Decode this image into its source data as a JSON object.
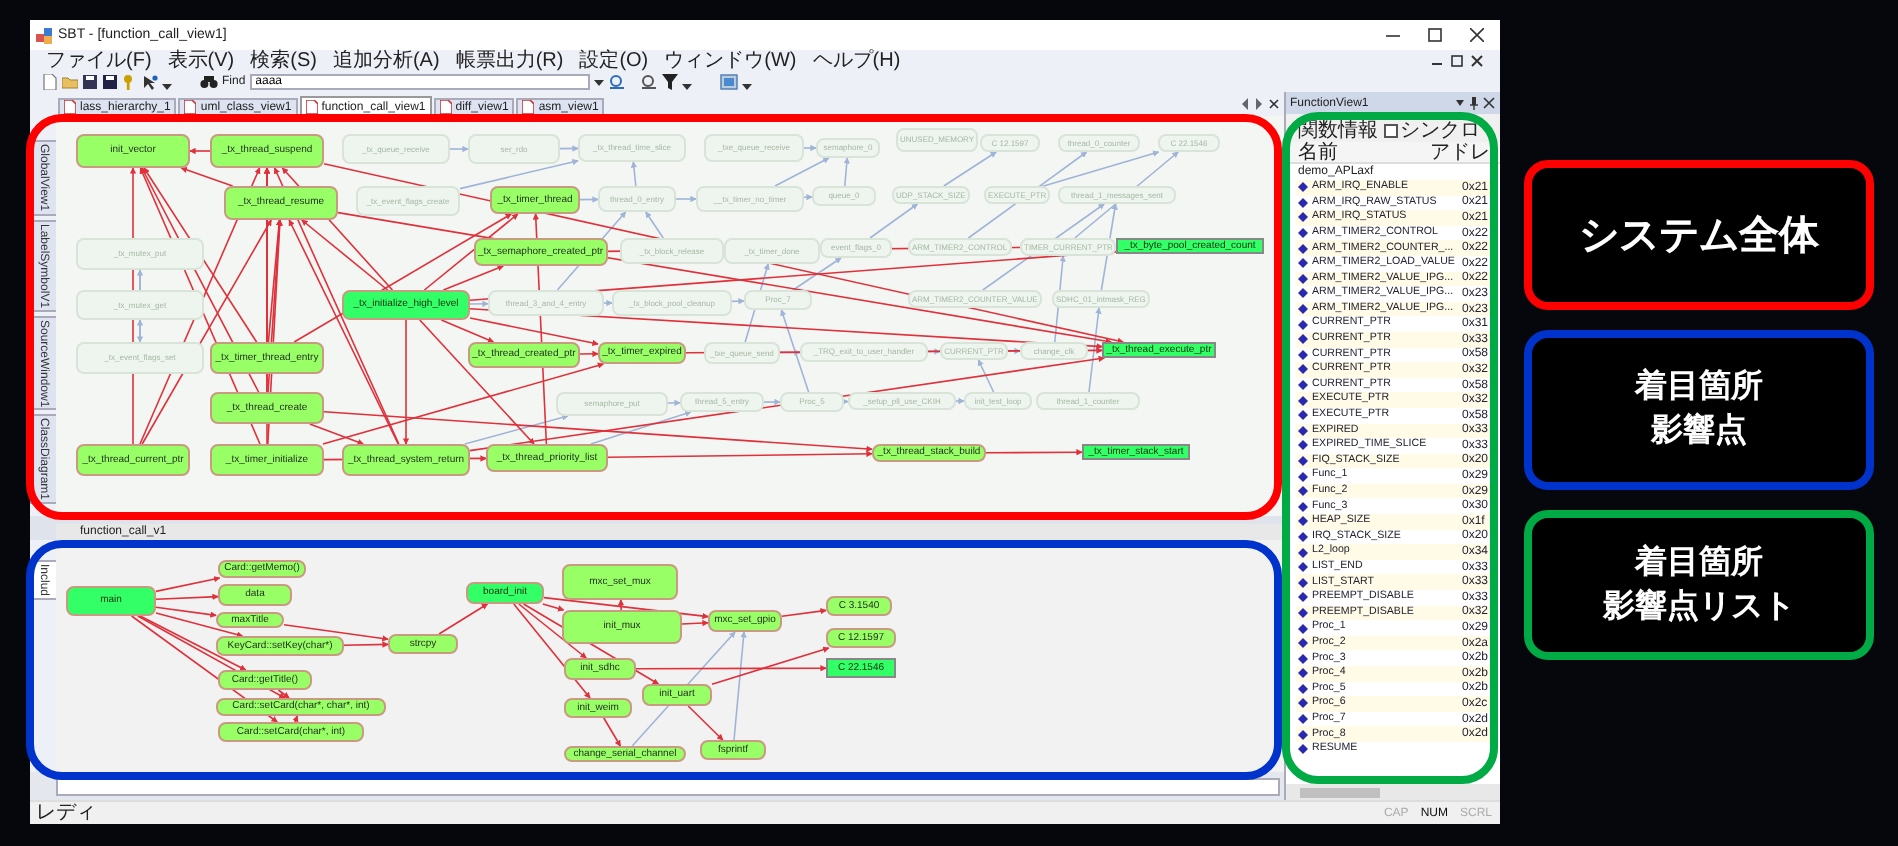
{
  "window": {
    "title": "SBT - [function_call_view1]"
  },
  "menu": [
    "ファイル(F)",
    "表示(V)",
    "検索(S)",
    "追加分析(A)",
    "帳票出力(R)",
    "設定(O)",
    "ウィンドウ(W)",
    "ヘルプ(H)"
  ],
  "toolbar": {
    "find_label": "Find",
    "find_value": "aaaa"
  },
  "document_tabs": [
    {
      "label": "lass_hierarchy_1",
      "selected": false
    },
    {
      "label": "uml_class_view1",
      "selected": false
    },
    {
      "label": "function_call_view1",
      "selected": true
    },
    {
      "label": "diff_view1",
      "selected": false
    },
    {
      "label": "asm_view1",
      "selected": false
    }
  ],
  "side_tabs": [
    "GlobalView1",
    "LabelSymbolV1",
    "SourceWindow1",
    "ClassDiagram1"
  ],
  "system_graph": {
    "nodes": [
      {
        "label": "init_vector",
        "kind": "node"
      },
      {
        "label": "_tx_thread_suspend",
        "kind": "node"
      },
      {
        "label": "_tx_thread_resume",
        "kind": "node"
      },
      {
        "label": "_tx_timer_thread",
        "kind": "node"
      },
      {
        "label": "_tx_semaphore_created_ptr",
        "kind": "node"
      },
      {
        "label": "_tx_initialize_high_level",
        "kind": "highlight"
      },
      {
        "label": "_tx_timer_thread_entry",
        "kind": "node"
      },
      {
        "label": "_tx_thread_created_ptr",
        "kind": "node"
      },
      {
        "label": "_tx_timer_expired",
        "kind": "node"
      },
      {
        "label": "_tx_thread_create",
        "kind": "node"
      },
      {
        "label": "_tx_thread_current_ptr",
        "kind": "node"
      },
      {
        "label": "_tx_timer_initialize",
        "kind": "node"
      },
      {
        "label": "_tx_thread_system_return",
        "kind": "node"
      },
      {
        "label": "_tx_thread_priority_list",
        "kind": "node"
      },
      {
        "label": "_tx_thread_stack_build",
        "kind": "node"
      },
      {
        "label": "_tx_byte_pool_created_count",
        "kind": "target"
      },
      {
        "label": "_tx_thread_execute_ptr",
        "kind": "target"
      },
      {
        "label": "_tx_timer_stack_start",
        "kind": "target"
      },
      {
        "label": "_tx_queue_receive",
        "kind": "faded"
      },
      {
        "label": "ser_rdo",
        "kind": "faded"
      },
      {
        "label": "_tx_thread_time_slice",
        "kind": "faded"
      },
      {
        "label": "_txe_queue_receive",
        "kind": "faded"
      },
      {
        "label": "semaphore_0",
        "kind": "faded"
      },
      {
        "label": "UNUSED_MEMORY",
        "kind": "faded"
      },
      {
        "label": "C 12.1597",
        "kind": "faded"
      },
      {
        "label": "thread_0_counter",
        "kind": "faded"
      },
      {
        "label": "C 22.1546",
        "kind": "faded"
      },
      {
        "label": "_tx_event_flags_create",
        "kind": "faded"
      },
      {
        "label": "thread_0_entry",
        "kind": "faded"
      },
      {
        "label": "__tx_timer_no_timer",
        "kind": "faded"
      },
      {
        "label": "queue_0",
        "kind": "faded"
      },
      {
        "label": "UDP_STACK_SIZE",
        "kind": "faded"
      },
      {
        "label": "EXECUTE_PTR",
        "kind": "faded"
      },
      {
        "label": "thread_1_messages_sent",
        "kind": "faded"
      },
      {
        "label": "_tx_mutex_put",
        "kind": "faded"
      },
      {
        "label": "_tx_block_release",
        "kind": "faded"
      },
      {
        "label": "_tx_timer_done",
        "kind": "faded"
      },
      {
        "label": "event_flags_0",
        "kind": "faded"
      },
      {
        "label": "ARM_TIMER2_CONTROL",
        "kind": "faded"
      },
      {
        "label": "TIMER_CURRENT_PTR",
        "kind": "faded"
      },
      {
        "label": "_tx_mutex_get",
        "kind": "faded"
      },
      {
        "label": "thread_3_and_4_entry",
        "kind": "faded"
      },
      {
        "label": "_tx_block_pool_cleanup",
        "kind": "faded"
      },
      {
        "label": "Proc_7",
        "kind": "faded"
      },
      {
        "label": "ARM_TIMER2_COUNTER_VALUE",
        "kind": "faded"
      },
      {
        "label": "SDHC_01_intmask_REG",
        "kind": "faded"
      },
      {
        "label": "_tx_event_flags_set",
        "kind": "faded"
      },
      {
        "label": "_txe_queue_send",
        "kind": "faded"
      },
      {
        "label": "_TRQ_exit_to_user_handler",
        "kind": "faded"
      },
      {
        "label": "CURRENT_PTR",
        "kind": "faded"
      },
      {
        "label": "change_clk",
        "kind": "faded"
      },
      {
        "label": "semaphore_put",
        "kind": "faded"
      },
      {
        "label": "thread_5_entry",
        "kind": "faded"
      },
      {
        "label": "Proc_5",
        "kind": "faded"
      },
      {
        "label": "_setup_pll_use_CKIH",
        "kind": "faded"
      },
      {
        "label": "init_test_loop",
        "kind": "faded"
      },
      {
        "label": "thread_1_counter",
        "kind": "faded"
      }
    ]
  },
  "bottom_pane": {
    "title": "function_call_v1",
    "side_tab": "Includ",
    "nodes": [
      {
        "label": "main",
        "kind": "highlight"
      },
      {
        "label": "Card::getMemo()",
        "kind": "node"
      },
      {
        "label": "data",
        "kind": "node"
      },
      {
        "label": "maxTitle",
        "kind": "node"
      },
      {
        "label": "KeyCard::setKey(char*)",
        "kind": "node"
      },
      {
        "label": "Card::getTitle()",
        "kind": "node"
      },
      {
        "label": "Card::setCard(char*, char*, int)",
        "kind": "node"
      },
      {
        "label": "Card::setCard(char*, int)",
        "kind": "node"
      },
      {
        "label": "strcpy",
        "kind": "node"
      },
      {
        "label": "board_init",
        "kind": "highlight"
      },
      {
        "label": "mxc_set_mux",
        "kind": "node"
      },
      {
        "label": "init_mux",
        "kind": "node"
      },
      {
        "label": "mxc_set_gpio",
        "kind": "node"
      },
      {
        "label": "C 3.1540",
        "kind": "node"
      },
      {
        "label": "C 12.1597",
        "kind": "node"
      },
      {
        "label": "C 22.1546",
        "kind": "target"
      },
      {
        "label": "init_sdhc",
        "kind": "node"
      },
      {
        "label": "init_uart",
        "kind": "node"
      },
      {
        "label": "init_weim",
        "kind": "node"
      },
      {
        "label": "change_serial_channel",
        "kind": "node"
      },
      {
        "label": "fsprintf",
        "kind": "node"
      }
    ]
  },
  "function_view": {
    "title": "FunctionView1",
    "info_label": "関数情報",
    "sync_checkbox": {
      "label": "シンクロ",
      "checked": false
    },
    "columns": [
      "名前",
      "アドレ"
    ],
    "file": "demo_APLaxf",
    "rows": [
      {
        "name": "ARM_IRQ_ENABLE",
        "address": "0x21"
      },
      {
        "name": "ARM_IRQ_RAW_STATUS",
        "address": "0x21"
      },
      {
        "name": "ARM_IRQ_STATUS",
        "address": "0x21"
      },
      {
        "name": "ARM_TIMER2_CONTROL",
        "address": "0x22"
      },
      {
        "name": "ARM_TIMER2_COUNTER_...",
        "address": "0x22"
      },
      {
        "name": "ARM_TIMER2_LOAD_VALUE",
        "address": "0x22"
      },
      {
        "name": "ARM_TIMER2_VALUE_IPG...",
        "address": "0x22"
      },
      {
        "name": "ARM_TIMER2_VALUE_IPG...",
        "address": "0x23"
      },
      {
        "name": "ARM_TIMER2_VALUE_IPG...",
        "address": "0x23"
      },
      {
        "name": "CURRENT_PTR",
        "address": "0x31"
      },
      {
        "name": "CURRENT_PTR",
        "address": "0x33"
      },
      {
        "name": "CURRENT_PTR",
        "address": "0x58"
      },
      {
        "name": "CURRENT_PTR",
        "address": "0x32"
      },
      {
        "name": "CURRENT_PTR",
        "address": "0x58"
      },
      {
        "name": "EXECUTE_PTR",
        "address": "0x32"
      },
      {
        "name": "EXECUTE_PTR",
        "address": "0x58"
      },
      {
        "name": "EXPIRED",
        "address": "0x33"
      },
      {
        "name": "EXPIRED_TIME_SLICE",
        "address": "0x33"
      },
      {
        "name": "FIQ_STACK_SIZE",
        "address": "0x20"
      },
      {
        "name": "Func_1",
        "address": "0x29"
      },
      {
        "name": "Func_2",
        "address": "0x29"
      },
      {
        "name": "Func_3",
        "address": "0x30"
      },
      {
        "name": "HEAP_SIZE",
        "address": "0x1f"
      },
      {
        "name": "IRQ_STACK_SIZE",
        "address": "0x20"
      },
      {
        "name": "L2_loop",
        "address": "0x34"
      },
      {
        "name": "LIST_END",
        "address": "0x33"
      },
      {
        "name": "LIST_START",
        "address": "0x33"
      },
      {
        "name": "PREEMPT_DISABLE",
        "address": "0x33"
      },
      {
        "name": "PREEMPT_DISABLE",
        "address": "0x32"
      },
      {
        "name": "Proc_1",
        "address": "0x29"
      },
      {
        "name": "Proc_2",
        "address": "0x2a"
      },
      {
        "name": "Proc_3",
        "address": "0x2b"
      },
      {
        "name": "Proc_4",
        "address": "0x2b"
      },
      {
        "name": "Proc_5",
        "address": "0x2b"
      },
      {
        "name": "Proc_6",
        "address": "0x2c"
      },
      {
        "name": "Proc_7",
        "address": "0x2d"
      },
      {
        "name": "Proc_8",
        "address": "0x2d"
      },
      {
        "name": "RESUME"
      }
    ]
  },
  "status_bar": {
    "text": "レディ",
    "indicators": [
      {
        "label": "CAP",
        "on": false
      },
      {
        "label": "NUM",
        "on": true
      },
      {
        "label": "SCRL",
        "on": false
      }
    ]
  },
  "annotations": [
    {
      "lines": [
        "システム全体"
      ],
      "color": "#ff0000"
    },
    {
      "lines": [
        "着目箇所",
        "影響点"
      ],
      "color": "#0033cc"
    },
    {
      "lines": [
        "着目箇所",
        "影響点リスト"
      ],
      "color": "#00aa44"
    }
  ]
}
